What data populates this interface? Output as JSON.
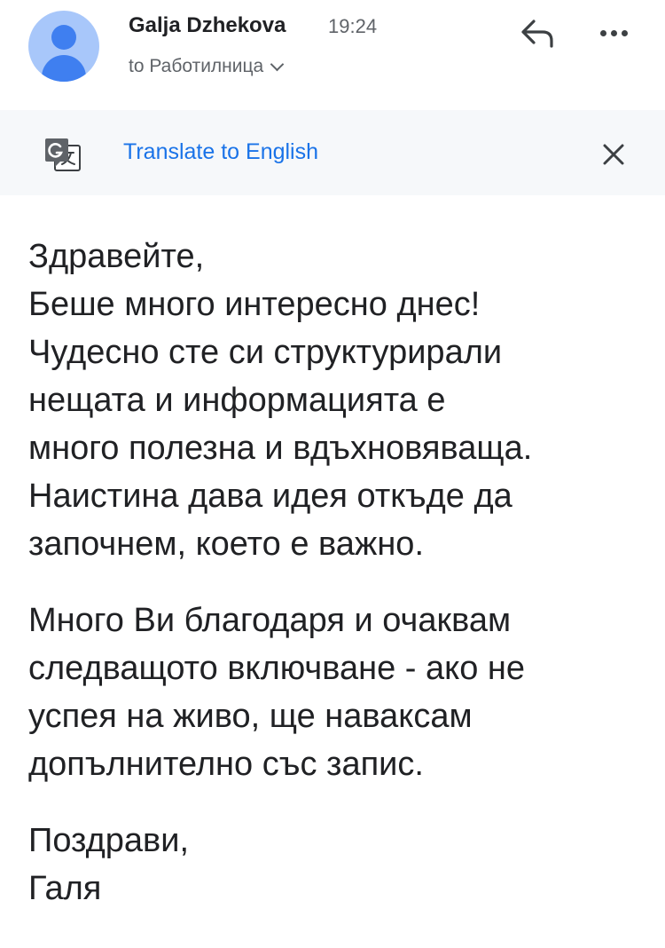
{
  "header": {
    "sender_name": "Galja Dzhekova",
    "time": "19:24",
    "recipient_line": "to Работилница",
    "avatar_icon": "person-icon",
    "reply_icon": "reply-icon",
    "more_icon": "more-options-icon"
  },
  "translate_bar": {
    "icon": "google-translate-icon",
    "link_text": "Translate to English",
    "close_icon": "close-icon"
  },
  "body": {
    "paragraphs": [
      {
        "lines": [
          "Здравейте,",
          "Беше много интересно днес!",
          "Чудесно сте си структурирали",
          "нещата и информацията е",
          "много полезна и вдъхновяваща.",
          "Наистина дава идея откъде да",
          "започнем, което е важно."
        ]
      },
      {
        "lines": [
          "Много Ви благодаря и очаквам",
          "следващото включване - ако не",
          "успея на живо, ще наваксам",
          "допълнително със запис."
        ]
      },
      {
        "lines": [
          "Поздрави,",
          "Галя"
        ]
      }
    ]
  },
  "colors": {
    "link": "#1a73e8",
    "avatar_bg": "#a8c7fa",
    "avatar_fg": "#3f7ff0",
    "banner_bg": "#f6f8fa"
  }
}
